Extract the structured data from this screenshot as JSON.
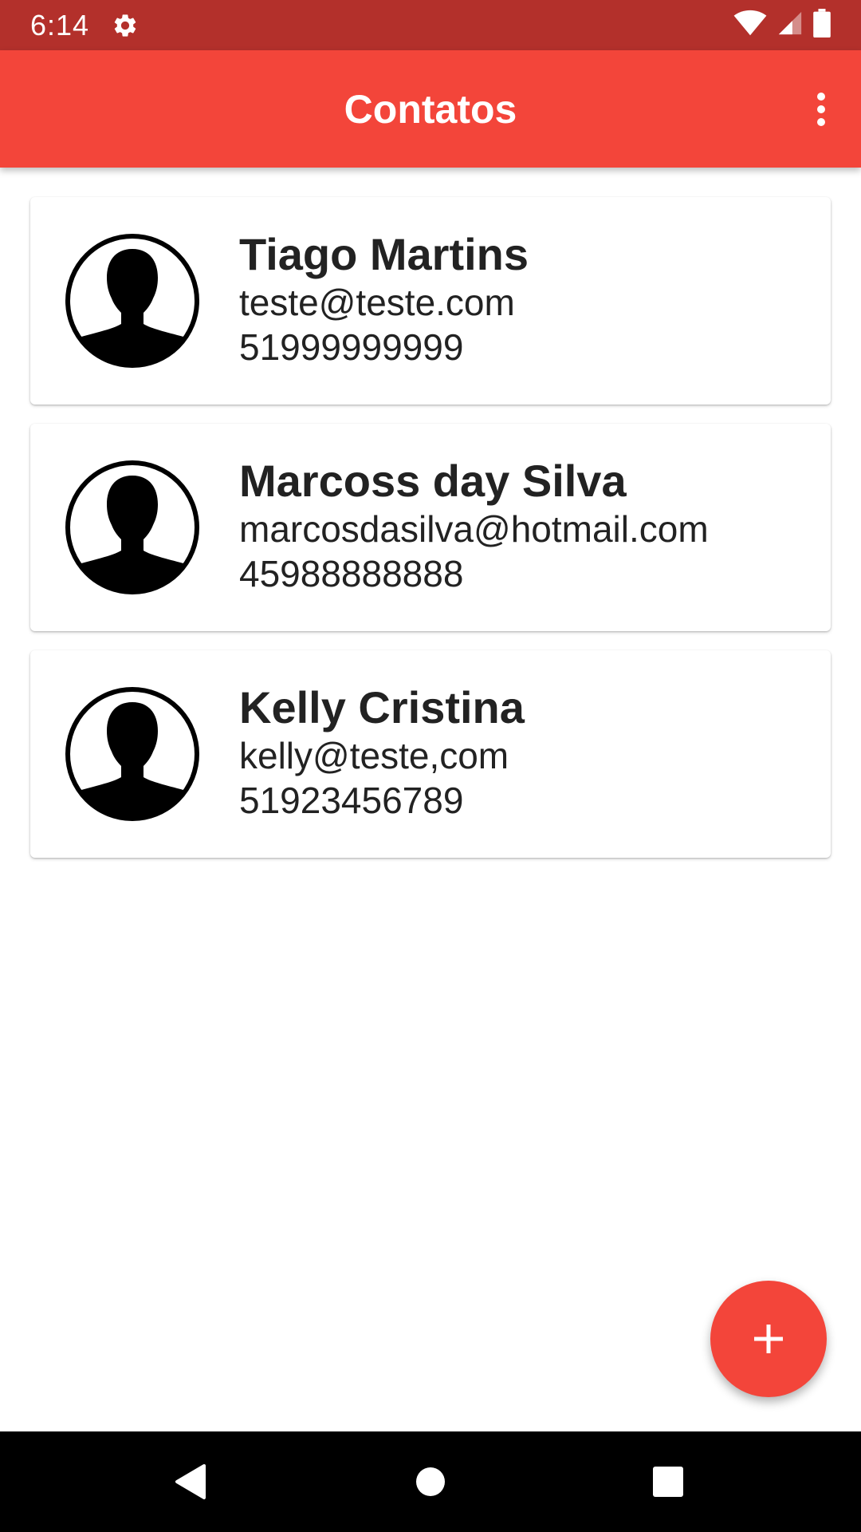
{
  "status_bar": {
    "time": "6:14",
    "icons": [
      "settings-icon",
      "wifi-icon",
      "signal-icon",
      "battery-icon"
    ]
  },
  "app_bar": {
    "title": "Contatos",
    "menu_icon": "more-vert-icon"
  },
  "contacts": [
    {
      "name": "Tiago Martins",
      "email": "teste@teste.com",
      "phone": "51999999999"
    },
    {
      "name": "Marcoss day Silva",
      "email": "marcosdasilva@hotmail.com",
      "phone": "45988888888"
    },
    {
      "name": "Kelly Cristina",
      "email": "kelly@teste,com",
      "phone": "51923456789"
    }
  ],
  "fab": {
    "icon": "add-icon"
  },
  "nav_bar": {
    "icons": [
      "back-icon",
      "home-icon",
      "recents-icon"
    ]
  },
  "colors": {
    "status_bar": "#b3302b",
    "app_bar": "#f3453a",
    "accent": "#f3453a"
  }
}
